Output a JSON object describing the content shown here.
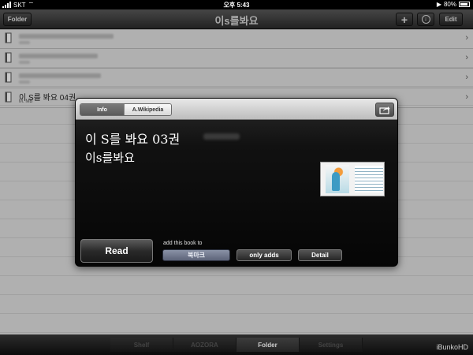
{
  "status": {
    "carrier": "SKT",
    "time": "오후 5:43",
    "battery": "80%"
  },
  "nav": {
    "folder": "Folder",
    "title": "이s를봐요",
    "add": "+",
    "edit": "Edit"
  },
  "list": {
    "rows": [
      {
        "title": "",
        "meta": "",
        "selected": false
      },
      {
        "title": "",
        "meta": "",
        "selected": false
      },
      {
        "title": "",
        "meta": "",
        "selected": false
      },
      {
        "title": "이 S를 봐요 04권",
        "meta": "M. MB",
        "selected": true
      }
    ]
  },
  "modal": {
    "tabs": {
      "info": "Info",
      "wiki": "A.Wikipedia"
    },
    "title": "이 S를 봐요 03권",
    "author": "이s를봐요",
    "read": "Read",
    "add_label": "add this book to",
    "bookmark": "북마크",
    "only_adds": "only adds",
    "detail": "Detail"
  },
  "tabbar": {
    "tabs": [
      "Shelf",
      "AOZORA",
      "Folder",
      "Settings"
    ],
    "active": 2,
    "brand": "iBunkoHD"
  },
  "colors": {
    "accent_button": "#6e7690",
    "nav_dark": "#2c2c2c"
  }
}
